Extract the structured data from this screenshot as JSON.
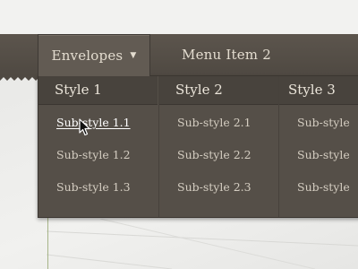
{
  "nav": {
    "items": [
      {
        "label": "Envelopes",
        "has_dropdown": true,
        "active": true
      },
      {
        "label": "Menu Item 2",
        "has_dropdown": false,
        "active": false
      }
    ]
  },
  "dropdown": {
    "columns": [
      {
        "heading": "Style 1",
        "items": [
          "Sub-style 1.1",
          "Sub-style 1.2",
          "Sub-style 1.3"
        ]
      },
      {
        "heading": "Style 2",
        "items": [
          "Sub-style 2.1",
          "Sub-style 2.2",
          "Sub-style 2.3"
        ]
      },
      {
        "heading": "Style 3",
        "items": [
          "Sub-style",
          "Sub-style",
          "Sub-style"
        ]
      }
    ],
    "hovered_item": "Sub-style 1.1"
  },
  "colors": {
    "navbar": "#554f48",
    "active_tab": "#625b53",
    "dropdown_bg": "#554f48",
    "text": "#e3dccf",
    "page_bg": "#ececea"
  },
  "icons": [
    "caret-down-icon",
    "mouse-pointer-icon"
  ]
}
